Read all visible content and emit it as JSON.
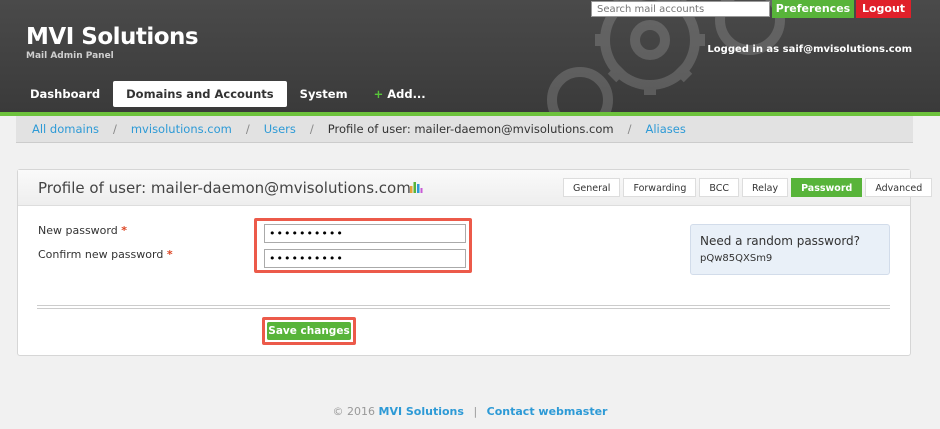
{
  "header": {
    "brand": "MVI Solutions",
    "tagline": "Mail Admin Panel",
    "search_placeholder": "Search mail accounts",
    "preferences_label": "Preferences",
    "logout_label": "Logout",
    "logged_in_text": "Logged in as saif@mvisolutions.com"
  },
  "nav": {
    "items": [
      {
        "label": "Dashboard"
      },
      {
        "label": "Domains and Accounts"
      },
      {
        "label": "System"
      },
      {
        "label": "Add..."
      }
    ],
    "add_symbol": "+"
  },
  "breadcrumb": {
    "separator": "/",
    "items": [
      {
        "label": "All domains"
      },
      {
        "label": "mvisolutions.com"
      },
      {
        "label": "Users"
      },
      {
        "label": "Profile of user: mailer-daemon@mvisolutions.com"
      },
      {
        "label": "Aliases"
      }
    ]
  },
  "panel": {
    "title": "Profile of user: mailer-daemon@mvisolutions.com",
    "tabs": [
      {
        "label": "General"
      },
      {
        "label": "Forwarding"
      },
      {
        "label": "BCC"
      },
      {
        "label": "Relay"
      },
      {
        "label": "Password"
      },
      {
        "label": "Advanced"
      }
    ],
    "new_password_label": "New password",
    "confirm_password_label": "Confirm new password",
    "required_mark": "*",
    "new_password_value": "••••••••••",
    "confirm_password_value": "••••••••••",
    "random_title": "Need a random password?",
    "random_value": "pQw85QXSm9",
    "save_label": "Save changes"
  },
  "footer": {
    "copyright": "© 2016",
    "company": "MVI Solutions",
    "separator": "|",
    "contact": "Contact webmaster"
  },
  "colors": {
    "accent_green": "#58b43a",
    "logout_red": "#e0202a",
    "link_blue": "#2d9ad6",
    "highlight_red": "#ec5a4a"
  }
}
